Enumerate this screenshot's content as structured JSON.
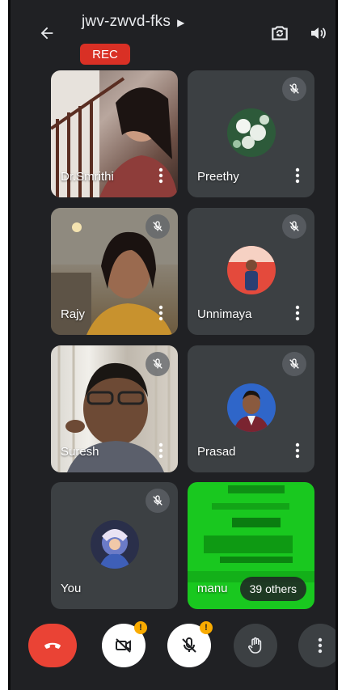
{
  "header": {
    "meeting_code": "jwv-zwvd-fks",
    "recording_label": "REC"
  },
  "participants": [
    {
      "name": "Dr.Smrithi",
      "muted": false,
      "has_video": true
    },
    {
      "name": "Preethy",
      "muted": true,
      "has_video": false
    },
    {
      "name": "Rajy",
      "muted": true,
      "has_video": true
    },
    {
      "name": "Unnimaya",
      "muted": true,
      "has_video": false
    },
    {
      "name": "Suresh",
      "muted": true,
      "has_video": true
    },
    {
      "name": "Prasad",
      "muted": true,
      "has_video": false
    },
    {
      "name": "You",
      "muted": true,
      "has_video": false
    },
    {
      "name": "manu",
      "muted": false,
      "has_video": true
    }
  ],
  "others_label": "39 others",
  "controls": {
    "camera_badge": "!",
    "mic_badge": "!"
  },
  "colors": {
    "background": "#202124",
    "tile": "#3c4043",
    "end_call": "#ea4335",
    "rec": "#d93025",
    "warning_badge": "#f9ab00",
    "green_video": "#19c81f"
  },
  "icons": [
    "back-arrow-icon",
    "chevron-right-icon",
    "switch-camera-icon",
    "speaker-icon",
    "mic-off-icon",
    "more-vert-icon",
    "call-end-icon",
    "camera-off-icon",
    "raise-hand-icon"
  ]
}
